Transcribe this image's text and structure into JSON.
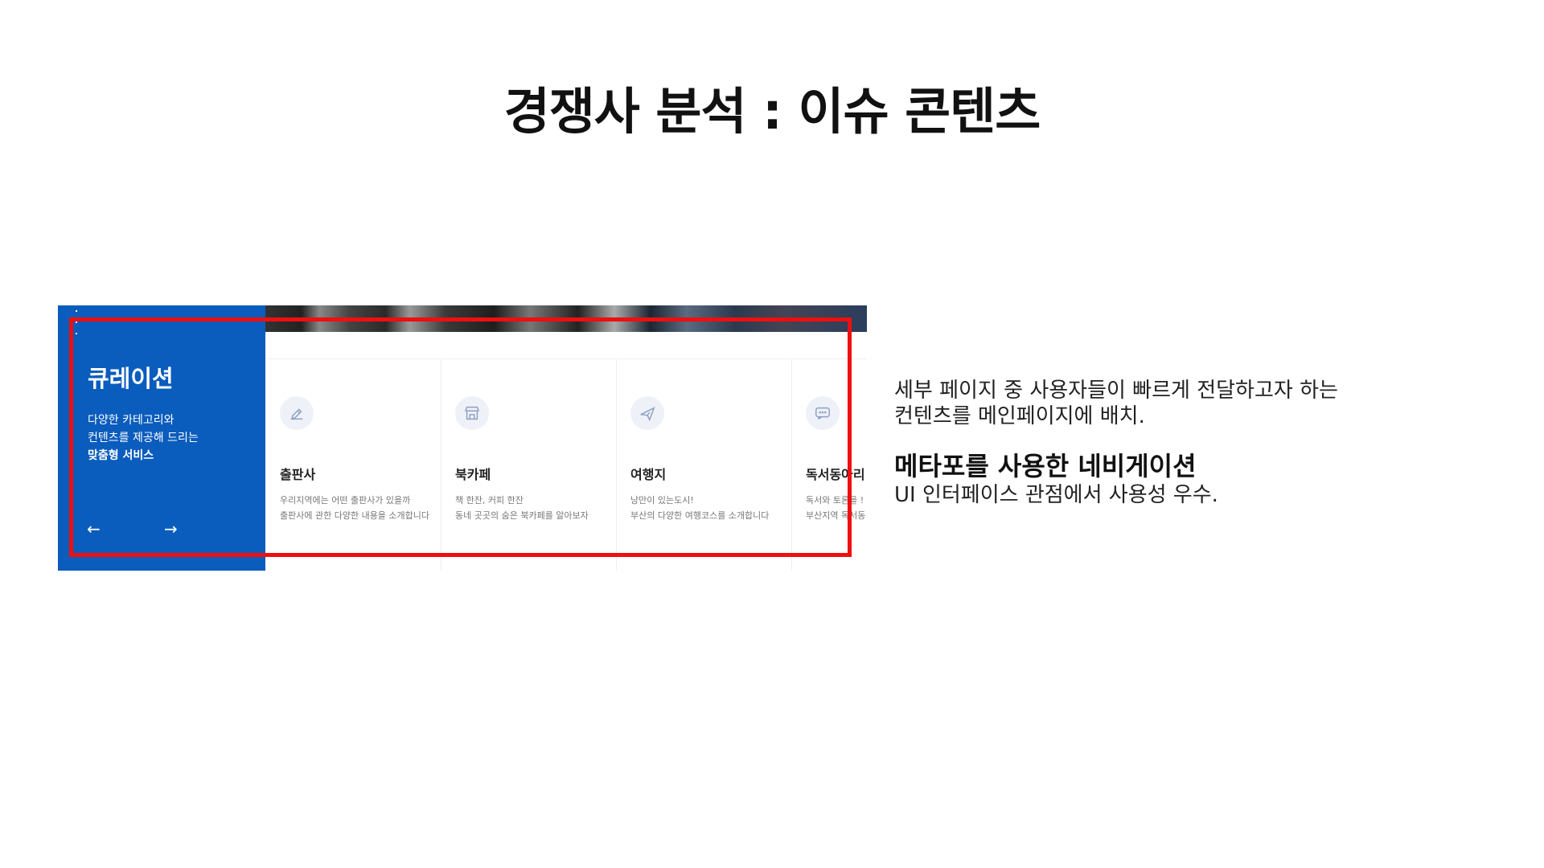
{
  "slide": {
    "title": "경쟁사 분석 : 이슈 콘텐츠"
  },
  "curation": {
    "title": "큐레이션",
    "desc_lines": [
      "다양한 카테고리와",
      "컨텐츠를 제공해 드리는",
      "맞춤형 서비스"
    ],
    "prev_arrow": "←",
    "next_arrow": "→"
  },
  "cards": [
    {
      "icon": "edit-pen-icon",
      "title": "출판사",
      "desc": [
        "우리지역에는 어떤 출판사가 있을까",
        "출판사에 관한 다양한 내용을 소개합니다"
      ]
    },
    {
      "icon": "storefront-icon",
      "title": "북카페",
      "desc": [
        "책 한잔, 커피 한잔",
        "동네 곳곳의 숨은 북카페를 알아보자"
      ]
    },
    {
      "icon": "airplane-icon",
      "title": "여행지",
      "desc": [
        "낭만이 있는도시!",
        "부산의 다양한 여행코스를 소개합니다"
      ]
    },
    {
      "icon": "chat-bubble-icon",
      "title": "독서동아리",
      "desc": [
        "독서와 토론을 !",
        "부산지역 독서동"
      ]
    }
  ],
  "note": {
    "line1": "세부 페이지 중 사용자들이 빠르게 전달하고자 하는",
    "line2": "컨텐츠를 메인페이지에 배치.",
    "heading": "메타포를 사용한 네비게이션",
    "line3": "UI 인터페이스 관점에서 사용성 우수."
  },
  "colors": {
    "accent_blue": "#0a5cbd",
    "highlight_red": "#f00e0e"
  }
}
